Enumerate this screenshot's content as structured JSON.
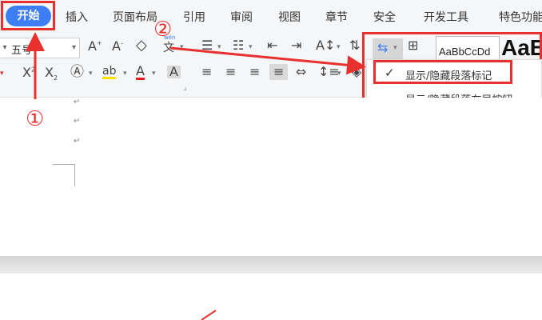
{
  "tabs": {
    "active": "开始",
    "items": [
      "插入",
      "页面布局",
      "引用",
      "审阅",
      "视图",
      "章节",
      "安全",
      "开发工具",
      "特色功能"
    ]
  },
  "toolbar": {
    "font_size_value": "五号",
    "text_wen": "wén",
    "text_wen_char": "文",
    "text_A": "A",
    "style_preview_label": "AaBbCcDd",
    "style_preview_big": "AaB"
  },
  "paragraph_menu": {
    "items": [
      {
        "label": "显示/隐藏段落标记",
        "checked": true
      },
      {
        "label": "显示/隐藏段落布局按钮",
        "checked": false
      }
    ]
  },
  "document": {
    "paragraph_mark": "↵"
  },
  "annotations": {
    "step1": "①",
    "step2": "②"
  },
  "colors": {
    "accent": "#3d7ef5",
    "annotation_red": "#e8312f"
  }
}
